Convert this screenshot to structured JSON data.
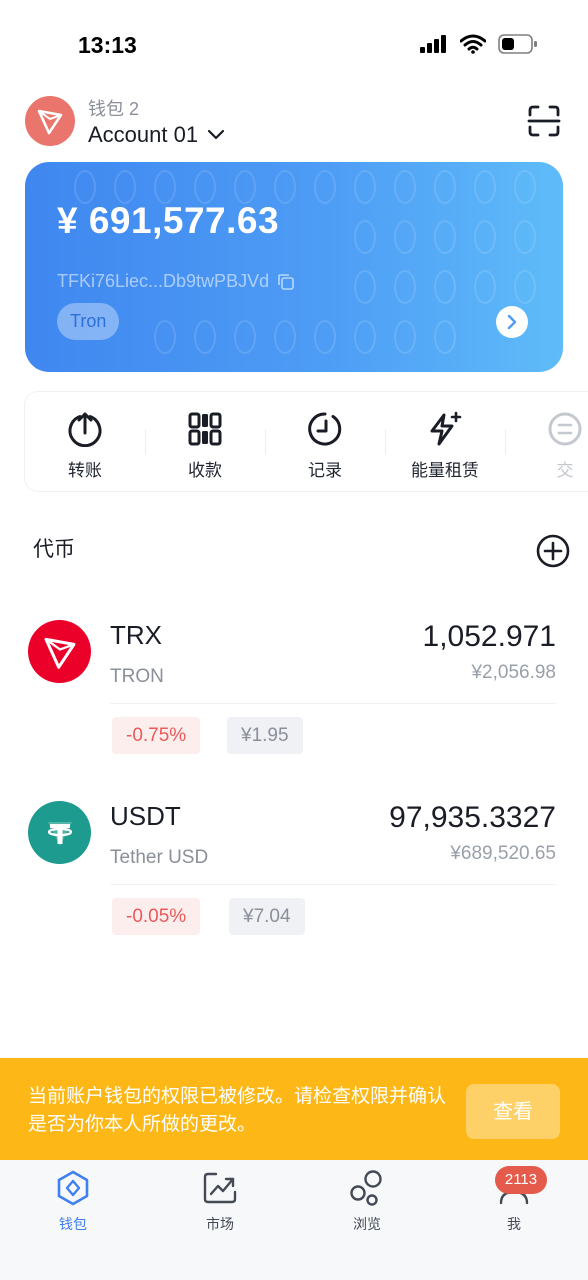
{
  "status_bar": {
    "time": "13:13"
  },
  "header": {
    "wallet_label": "钱包 2",
    "account_name": "Account 01",
    "icons": [
      "tron-avatar-icon",
      "chevron-down-icon",
      "scan-icon"
    ]
  },
  "balance_card": {
    "balance": "¥ 691,577.63",
    "address": "TFKi76Liec...Db9twPBJVd",
    "chain": "Tron",
    "colors": {
      "gradient_start": "#3f87ef",
      "gradient_end": "#5fbcf9"
    }
  },
  "actions": [
    {
      "label": "转账",
      "icon": "transfer-icon"
    },
    {
      "label": "收款",
      "icon": "receive-qr-icon"
    },
    {
      "label": "记录",
      "icon": "history-clock-icon"
    },
    {
      "label": "能量租赁",
      "icon": "energy-bolt-icon"
    },
    {
      "label": "交",
      "icon": "exchange-icon"
    }
  ],
  "tokens_section": {
    "title": "代币"
  },
  "tokens": [
    {
      "symbol": "TRX",
      "name": "TRON",
      "amount": "1,052.971",
      "fiat": "¥2,056.98",
      "change": "-0.75%",
      "price": "¥1.95",
      "logo_color": "#eb0029"
    },
    {
      "symbol": "USDT",
      "name": "Tether USD",
      "amount": "97,935.3327",
      "fiat": "¥689,520.65",
      "change": "-0.05%",
      "price": "¥7.04",
      "logo_color": "#1c9b8e"
    }
  ],
  "banner": {
    "message": "当前账户钱包的权限已被修改。请检查权限并确认是否为你本人所做的更改。",
    "button": "查看",
    "color": "#fdb817"
  },
  "bottom_nav": {
    "items": [
      {
        "label": "钱包",
        "icon": "wallet-icon",
        "active": true
      },
      {
        "label": "市场",
        "icon": "market-chart-icon",
        "active": false
      },
      {
        "label": "浏览",
        "icon": "discover-icon",
        "active": false
      },
      {
        "label": "我",
        "icon": "profile-icon",
        "active": false
      }
    ],
    "badge": "2113",
    "accent": "#3f7ff0"
  }
}
